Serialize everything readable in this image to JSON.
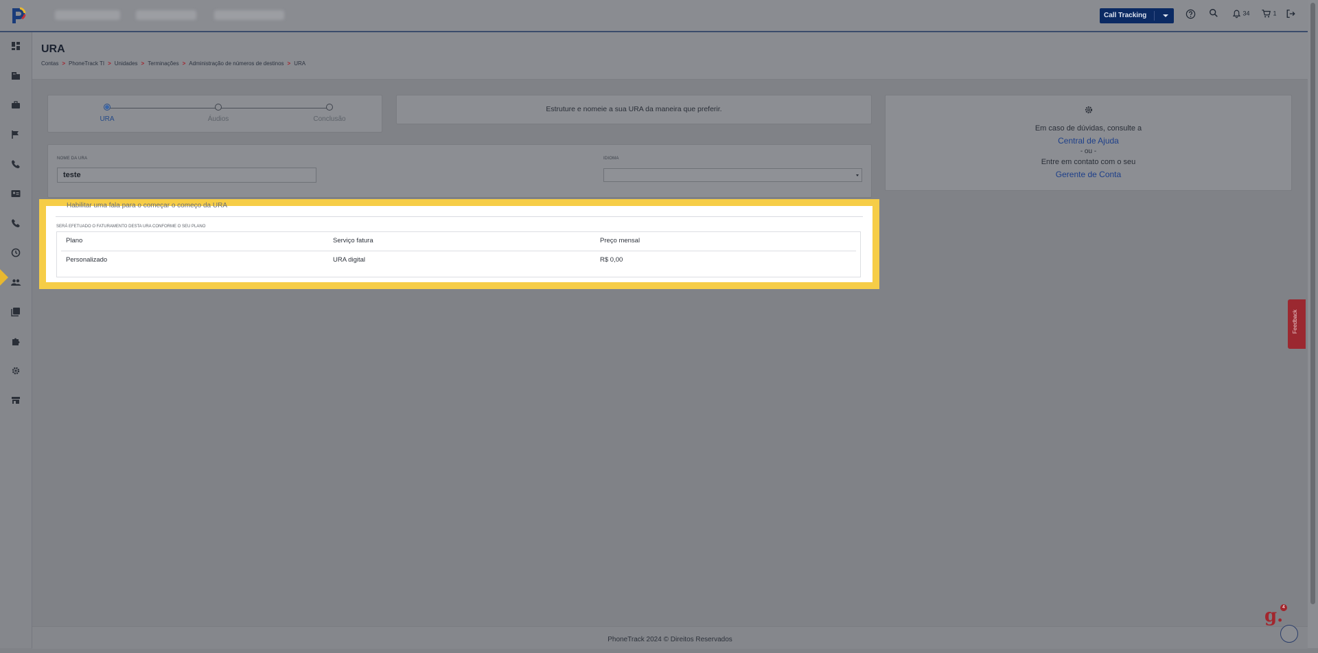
{
  "topbar": {
    "product_select": "Call Tracking",
    "notifications_count": "34",
    "cart_count": "1"
  },
  "page": {
    "title": "URA",
    "breadcrumb": [
      "Contas",
      "PhoneTrack TI",
      "Unidades",
      "Terminações",
      "Administração de números de destinos",
      "URA"
    ]
  },
  "stepper": {
    "steps": [
      "URA",
      "Áudios",
      "Conclusão"
    ],
    "active_index": 0
  },
  "instructions": {
    "message": "Estruture e nomeie a sua URA da maneira que preferir."
  },
  "help": {
    "line1": "Em caso de dúvidas, consulte a",
    "link1": "Central de Ajuda",
    "or": "- ou -",
    "line2": "Entre em contato com o seu",
    "link2": "Gerente de Conta"
  },
  "form": {
    "name_label": "Nome da URA",
    "name_value": "teste",
    "language_label": "Idioma",
    "language_value": ""
  },
  "billing": {
    "cut_text": "Habilitar uma fala para o começar o começo da URA",
    "label": "Será efetuado o faturamento desta URA conforme o seu plano",
    "headers": [
      "Plano",
      "Serviço fatura",
      "Preço mensal"
    ],
    "row": [
      "Personalizado",
      "URA digital",
      "R$ 0,00"
    ]
  },
  "footer": {
    "text": "PhoneTrack 2024 © Direitos Reservados"
  },
  "feedback": {
    "label": "Feedback"
  },
  "chat": {
    "badge_count": "4"
  }
}
